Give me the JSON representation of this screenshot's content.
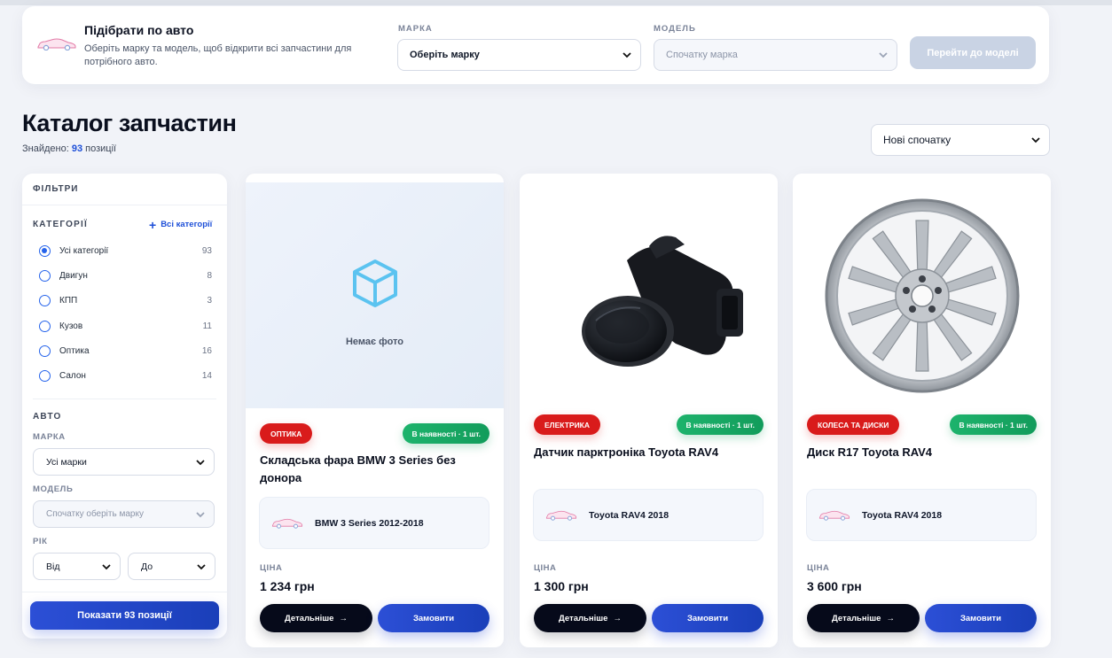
{
  "picker": {
    "title": "Підібрати по авто",
    "description": "Оберіть марку та модель, щоб відкрити всі запчастини для потрібного авто.",
    "brand_label": "МАРКА",
    "brand_value": "Оберіть марку",
    "model_label": "МОДЕЛЬ",
    "model_value": "Спочатку марка",
    "go_button": "Перейти до моделі"
  },
  "catalog": {
    "title": "Каталог запчастин",
    "found_prefix": "Знайдено:",
    "found_count": "93",
    "found_suffix": "позиції",
    "sort_value": "Нові спочатку"
  },
  "filters": {
    "header": "ФІЛЬТРИ",
    "categories_label": "КАТЕГОРІЇ",
    "all_categories_link": "Всі категорії",
    "categories": [
      {
        "label": "Усі категорії",
        "count": "93",
        "selected": true
      },
      {
        "label": "Двигун",
        "count": "8",
        "selected": false
      },
      {
        "label": "КПП",
        "count": "3",
        "selected": false
      },
      {
        "label": "Кузов",
        "count": "11",
        "selected": false
      },
      {
        "label": "Оптика",
        "count": "16",
        "selected": false
      },
      {
        "label": "Салон",
        "count": "14",
        "selected": false
      }
    ],
    "auto_label": "АВТО",
    "brand_label": "МАРКА",
    "brand_value": "Усі марки",
    "model_label": "МОДЕЛЬ",
    "model_value": "Спочатку оберіть марку",
    "year_label": "РІК",
    "year_from": "Від",
    "year_to": "До",
    "show_button": "Показати 93 позиції"
  },
  "products": [
    {
      "category": "ОПТИКА",
      "stock": "В наявності · 1 шт.",
      "title": "Складська фара BMW 3 Series без донора",
      "car": "BMW 3 Series 2012-2018",
      "price_label": "ЦІНА",
      "price": "1 234 грн",
      "details_button": "Детальніше",
      "order_button": "Замовити",
      "no_photo": "Немає фото"
    },
    {
      "category": "ЕЛЕКТРИКА",
      "stock": "В наявності · 1 шт.",
      "title": "Датчик парктроніка Toyota RAV4",
      "car": "Toyota RAV4 2018",
      "price_label": "ЦІНА",
      "price": "1 300 грн",
      "details_button": "Детальніше",
      "order_button": "Замовити"
    },
    {
      "category": "КОЛЕСА ТА ДИСКИ",
      "stock": "В наявності · 1 шт.",
      "title": "Диск R17 Toyota RAV4",
      "car": "Toyota RAV4 2018",
      "price_label": "ЦІНА",
      "price": "3 600 грн",
      "details_button": "Детальніше",
      "order_button": "Замовити"
    }
  ],
  "icons": {
    "car": "car-icon",
    "box": "box-icon",
    "chevron": "chevron-down-icon",
    "arrow": "arrow-right-icon",
    "plus": "plus-icon"
  },
  "colors": {
    "accent": "#1d4fd8",
    "category_badge": "#d91b1b",
    "stock_badge": "#1db36c",
    "dark_button": "#060a1a"
  }
}
